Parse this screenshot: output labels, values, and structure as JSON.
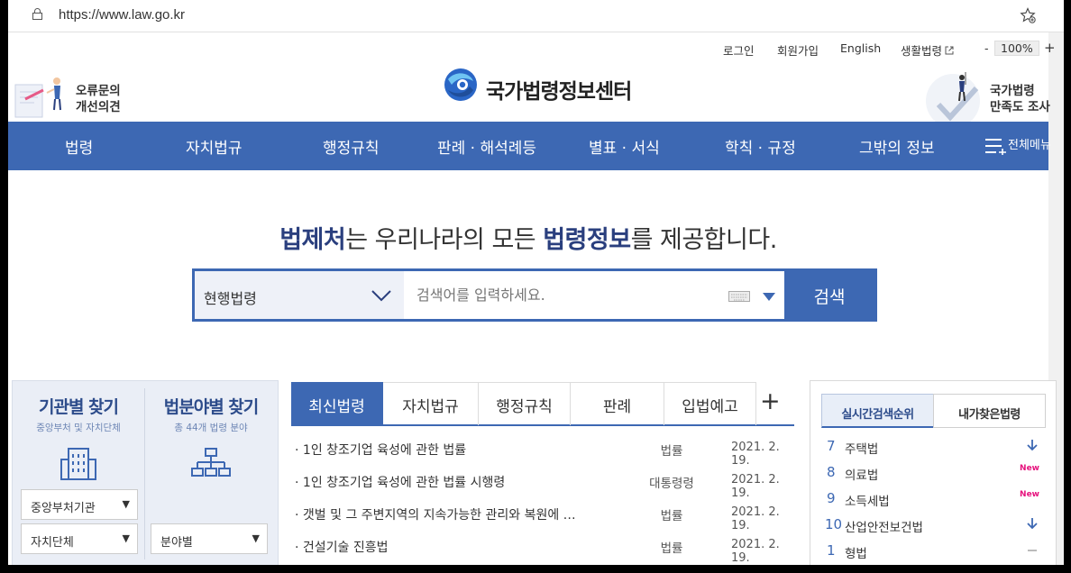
{
  "browser": {
    "url": "https://www.law.go.kr"
  },
  "util_links": [
    "로그인",
    "회원가입",
    "English",
    "생활법령"
  ],
  "zoom": {
    "minus": "-",
    "value": "100%",
    "plus": "+"
  },
  "header": {
    "error_report": [
      "오류문의",
      "개선의견"
    ],
    "logo_text": "국가법령정보센터",
    "survey": [
      "국가법령",
      "만족도 조사"
    ]
  },
  "nav": {
    "items": [
      "법령",
      "자치법규",
      "행정규칙",
      "판례 · 해석례등",
      "별표 · 서식",
      "학칙 · 규정",
      "그밖의 정보"
    ],
    "all_menu": "전체메뉴"
  },
  "headline": {
    "b1": "법제처",
    "t1": "는 우리나라의 모든 ",
    "b2": "법령정보",
    "t2": "를 제공합니다."
  },
  "search": {
    "select": "현행법령",
    "placeholder": "검색어를 입력하세요.",
    "button": "검색"
  },
  "left_panel": {
    "agency": {
      "title": "기관별 찾기",
      "sub": "중앙부처 및 자치단체",
      "dd1": "중앙부처기관",
      "dd2": "자치단체"
    },
    "field": {
      "title": "법분야별 찾기",
      "sub": "총 44개 법령 분야",
      "dd1": "분야별"
    }
  },
  "tabs": [
    "최신법령",
    "자치법규",
    "행정규칙",
    "판례",
    "입법예고"
  ],
  "tabs_more": "+",
  "list": [
    {
      "title": "1인 창조기업 육성에 관한 법률",
      "kind": "법률",
      "date": "2021. 2. 19."
    },
    {
      "title": "1인 창조기업 육성에 관한 법률 시행령",
      "kind": "대통령령",
      "date": "2021. 2. 19."
    },
    {
      "title": "갯벌 및 그 주변지역의 지속가능한 관리와 복원에 …",
      "kind": "법률",
      "date": "2021. 2. 19."
    },
    {
      "title": "건설기술 진흥법",
      "kind": "법률",
      "date": "2021. 2. 19."
    }
  ],
  "right_panel": {
    "tab_active": "실시간검색순위",
    "tab_other": "내가찾은법령",
    "ranks": [
      {
        "n": "7",
        "word": "주택법",
        "status": "down"
      },
      {
        "n": "8",
        "word": "의료법",
        "status": "New"
      },
      {
        "n": "9",
        "word": "소득세법",
        "status": "New"
      },
      {
        "n": "10",
        "word": "산업안전보건법",
        "status": "down"
      },
      {
        "n": "1",
        "word": "형법",
        "status": "same"
      }
    ]
  },
  "colors": {
    "brand": "#3d68b3",
    "accent_dark": "#2a3f7e",
    "new": "#e6127d"
  }
}
